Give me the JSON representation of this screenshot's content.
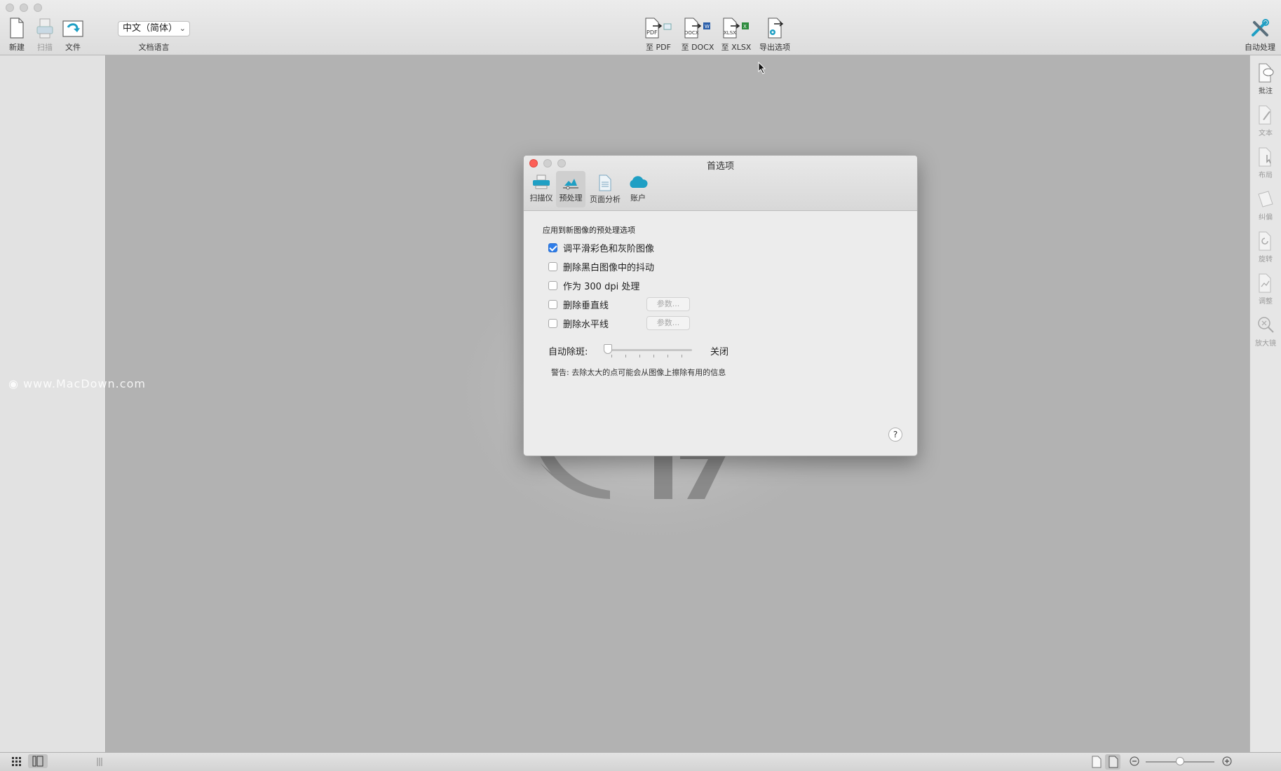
{
  "toolbar": {
    "new_label": "新建",
    "scan_label": "扫描",
    "file_label": "文件",
    "language_value": "中文（简体）",
    "language_label": "文档语言",
    "to_pdf_label": "至 PDF",
    "to_docx_label": "至 DOCX",
    "to_xlsx_label": "至 XLSX",
    "export_options_label": "导出选项",
    "auto_process_label": "自动处理",
    "pdf_icon_text": "PDF",
    "docx_icon_text": "DOCX",
    "xlsx_icon_text": "XLSX"
  },
  "right_panel": {
    "items": [
      "批注",
      "文本",
      "布局",
      "纠偏",
      "旋转",
      "调整",
      "放大镜"
    ]
  },
  "watermark": "www.MacDown.com",
  "dialog": {
    "title": "首选项",
    "tabs": [
      "扫描仪",
      "预处理",
      "页面分析",
      "账户"
    ],
    "selected_tab": "预处理",
    "section_label": "应用到新图像的预处理选项",
    "options": [
      {
        "label": "调平滑彩色和灰阶图像",
        "checked": true
      },
      {
        "label": "删除黑白图像中的抖动",
        "checked": false
      },
      {
        "label": "作为 300 dpi 处理",
        "checked": false
      },
      {
        "label": "删除垂直线",
        "checked": false
      },
      {
        "label": "删除水平线",
        "checked": false
      }
    ],
    "params_button_label": "参数...",
    "despeckle_label": "自动除斑:",
    "despeckle_value": "关闭",
    "despeckle_level": 0,
    "warning": "警告:  去除太大的点可能会从图像上擦除有用的信息",
    "help_label": "?"
  },
  "colors": {
    "accent": "#2e7de9",
    "icon_teal": "#1f9fc4",
    "close_red": "#fc5f57"
  }
}
